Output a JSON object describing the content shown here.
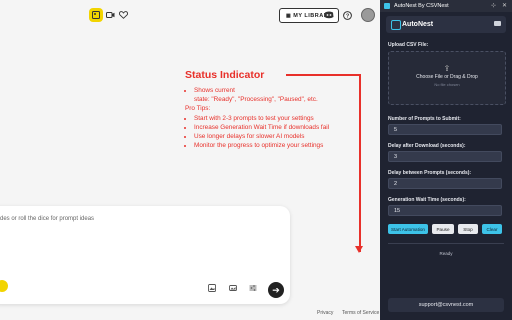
{
  "toolbar": {
    "library_label": "MY LIBRARY",
    "icons": [
      "image-icon",
      "video-icon",
      "heart-icon",
      "discord-icon",
      "help-icon",
      "avatar"
    ]
  },
  "annotation": {
    "title": "Status Indicator",
    "bullet1_line1": "Shows current",
    "bullet1_line2": "state: \"Ready\", \"Processing\", \"Paused\", etc.",
    "pro_tips_label": "Pro Tips:",
    "tips": [
      "Start with 2-3 prompts to test your settings",
      "Increase Generation Wait Time if downloads fail",
      "Use longer delays for slower AI models",
      "Monitor the progress to optimize your settings"
    ],
    "color": "#e8302a"
  },
  "prompt": {
    "placeholder": "des or roll the dice for prompt ideas"
  },
  "footer": {
    "privacy": "Privacy",
    "terms": "Terms of Service"
  },
  "panel": {
    "window_title": "AutoNest By CSVNest",
    "brand": "AutoNest",
    "upload_label": "Upload CSV File:",
    "upload_text": "Choose File or Drag & Drop",
    "upload_sub": "No file chosen",
    "fields": [
      {
        "label": "Number of Prompts to Submit:",
        "value": "5"
      },
      {
        "label": "Delay after Download (seconds):",
        "value": "3"
      },
      {
        "label": "Delay between Prompts (seconds):",
        "value": "2"
      },
      {
        "label": "Generation Wait Time (seconds):",
        "value": "15"
      }
    ],
    "buttons": {
      "start": "Start Automation",
      "pause": "Pause",
      "stop": "Stop",
      "clear": "Clear"
    },
    "status": "Ready",
    "support": "support@csvnest.com",
    "accent": "#3dc3e8"
  }
}
